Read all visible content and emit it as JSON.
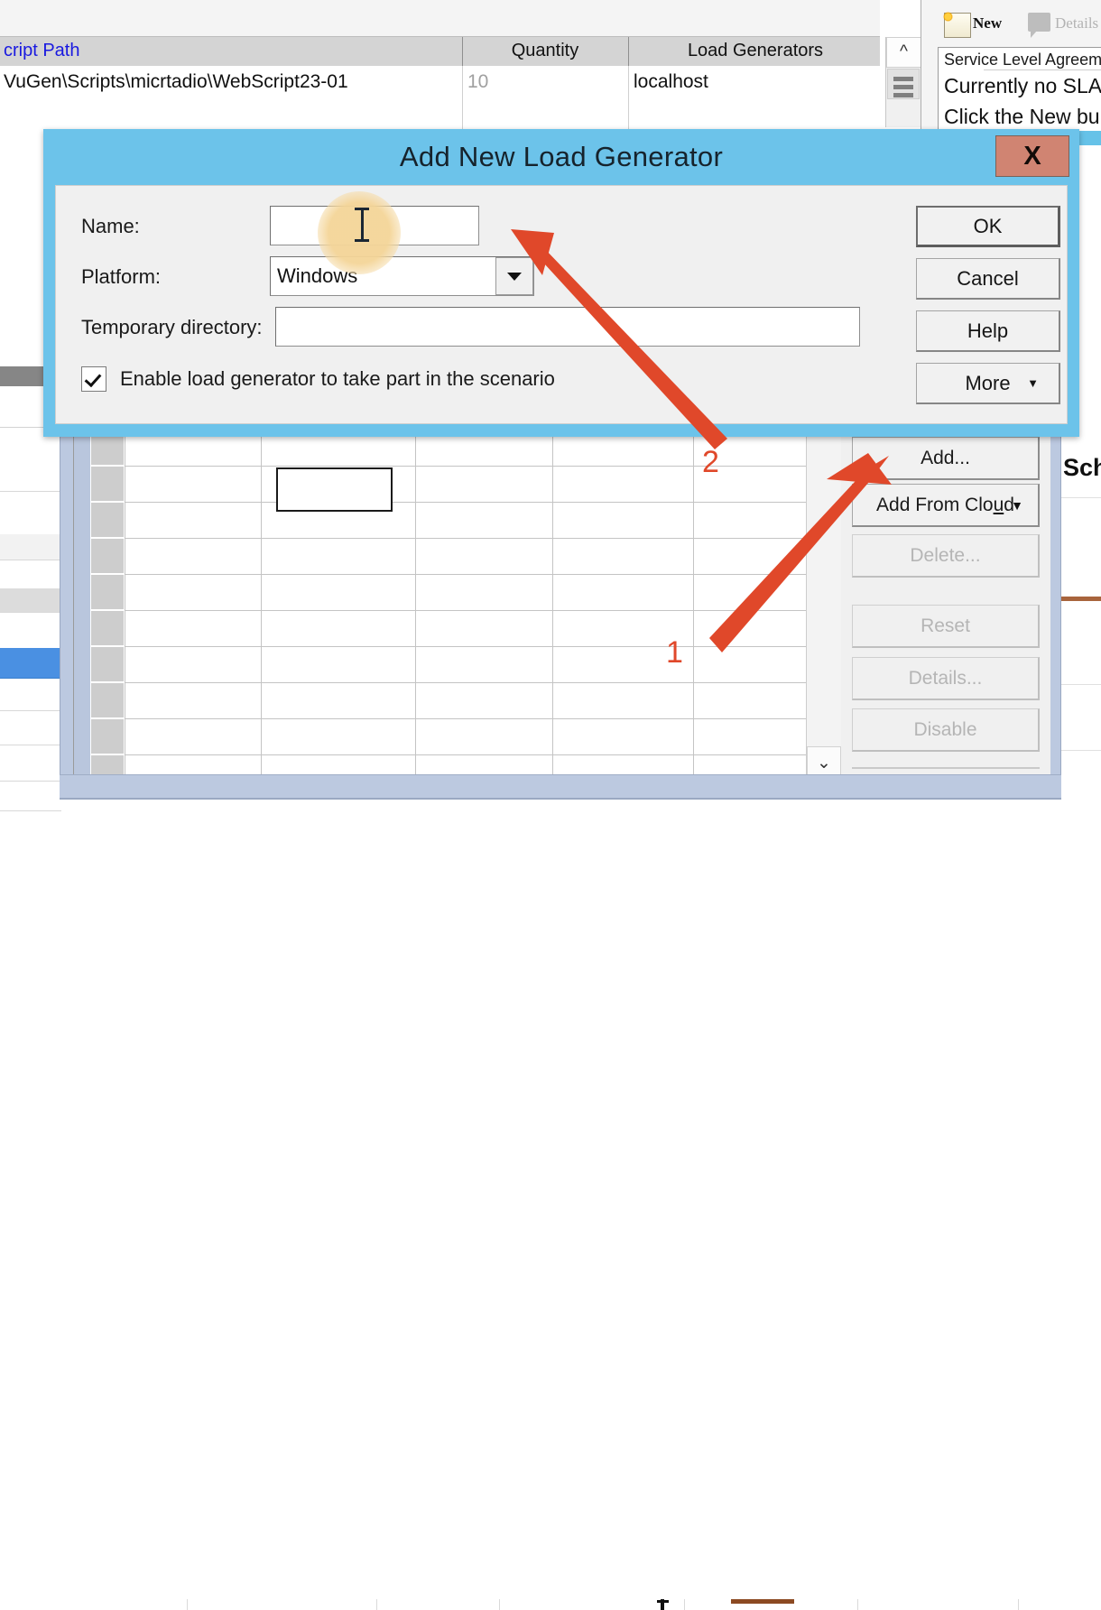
{
  "app": {
    "table": {
      "columns": [
        "cript Path",
        "Quantity",
        "Load Generators"
      ],
      "rows": [
        {
          "script_path": "VuGen\\Scripts\\micrtadio\\WebScript23-01",
          "quantity": "10",
          "load_generators": "localhost"
        },
        {
          "script_path": "",
          "quantity": "",
          "load_generators": ""
        }
      ],
      "scroll_up_icon": "chevron-up-icon"
    },
    "sla_panel": {
      "new_label": "New",
      "details_label": "Details",
      "new_icon": "new-document-icon",
      "details_icon": "comment-details-icon",
      "box_header": "Service Level Agreeme",
      "line1": "Currently no SLA",
      "line2": "Click the New bu"
    },
    "group_buttons": [
      {
        "label": "Add...",
        "enabled": true,
        "has_caret": false
      },
      {
        "label": "Add From Cloud",
        "enabled": true,
        "has_caret": true,
        "caret": "▼"
      },
      {
        "label": "Delete...",
        "enabled": false,
        "has_caret": false
      },
      {
        "label": "Reset",
        "enabled": false,
        "has_caret": false
      },
      {
        "label": "Details...",
        "enabled": false,
        "has_caret": false
      },
      {
        "label": "Disable",
        "enabled": false,
        "has_caret": false
      }
    ],
    "grid_scroll_down_icon": "chevron-down-icon",
    "far_right_label": "Sch"
  },
  "dialog": {
    "title": "Add New Load Generator",
    "close_label": "X",
    "close_icon": "close-icon",
    "fields": [
      {
        "label": "Name:",
        "value": "",
        "type": "text"
      },
      {
        "label": "Platform:",
        "value": "Windows",
        "type": "combobox"
      },
      {
        "label": "Temporary directory:",
        "value": "",
        "type": "text"
      }
    ],
    "checkbox": {
      "label": "Enable load generator to take part in the scenario",
      "checked": true
    },
    "buttons": [
      {
        "label": "OK",
        "primary": true
      },
      {
        "label": "Cancel",
        "primary": false
      },
      {
        "label": "Help",
        "primary": false
      },
      {
        "label": "More",
        "primary": false,
        "caret": "▼"
      }
    ]
  },
  "annotations": [
    {
      "number": "1",
      "target": "add-button"
    },
    {
      "number": "2",
      "target": "name-field"
    }
  ],
  "colors": {
    "dialog_title_bar": "#6cc3ea",
    "close_button": "#d08472",
    "annotation_red": "#e0482a",
    "selected_row": "#4a90e2",
    "header_link_text": "#1919e0",
    "cursor_highlight": "#f4d598"
  }
}
